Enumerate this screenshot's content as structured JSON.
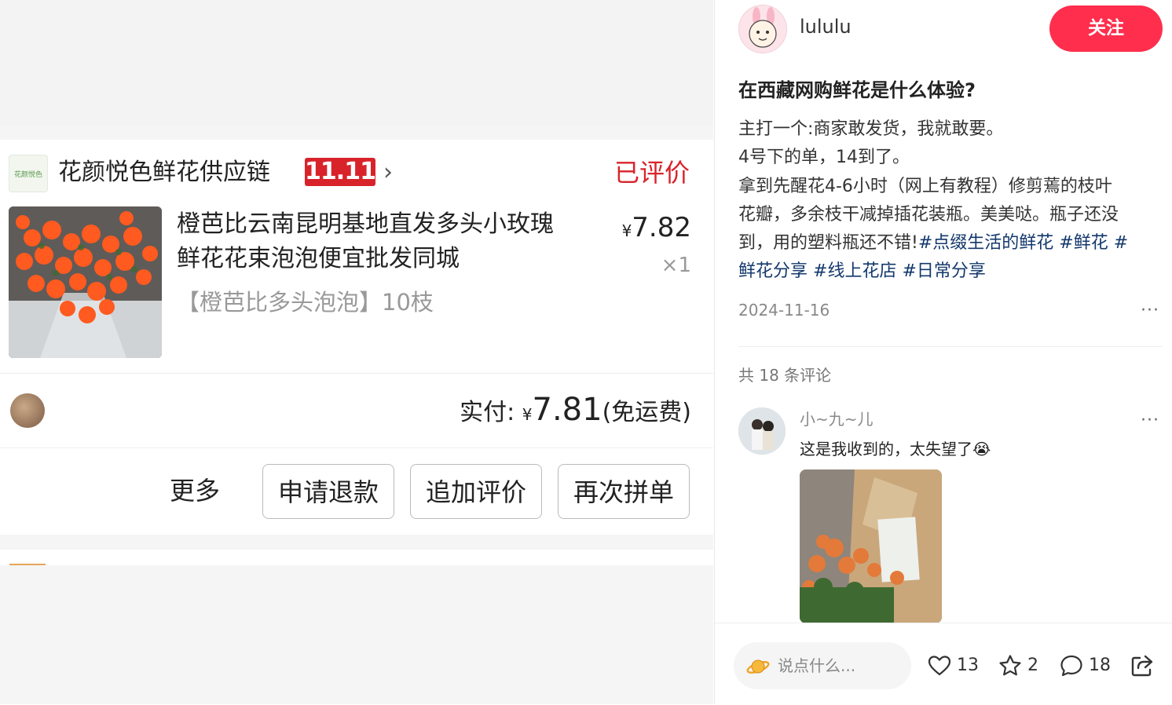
{
  "order": {
    "shop_name": "花颜悦色鲜花供应链",
    "shop_logo_text": "花颜悦色",
    "promo_badge": "11.11",
    "chevron": "›",
    "status": "已评价",
    "product": {
      "title_line1": "橙芭比云南昆明基地直发多头小玫瑰",
      "title_line2": "鲜花花束泡泡便宜批发同城",
      "spec": "【橙芭比多头泡泡】10枝",
      "price_symbol": "¥",
      "price": "7.82",
      "quantity": "×1"
    },
    "paid_label": "实付:",
    "paid_symbol": "¥",
    "paid_amount": "7.81",
    "paid_note": "(免运费)",
    "more_label": "更多",
    "buttons": [
      "申请退款",
      "追加评价",
      "再次拼单"
    ]
  },
  "post": {
    "author_name": "lululu",
    "follow_label": "关注",
    "title": "在西藏网购鲜花是什么体验?",
    "body_line1": "主打一个:商家敢发货，我就敢要。",
    "body_line2": "4号下的单，14到了。",
    "body_line3": "拿到先醒花4-6小时（网上有教程）修剪蔫的枝叶",
    "body_line4": "花瓣，多余枝干减掉插花装瓶。美美哒。瓶子还没",
    "body_line5_text": "到，用的塑料瓶还不错!",
    "tags": [
      "#点缀生活的鲜花",
      "#鲜花",
      "#",
      "鲜花分享",
      "#线上花店",
      "#日常分享"
    ],
    "date": "2024-11-16",
    "more_dots": "···"
  },
  "comments": {
    "count_label": "共 18 条评论",
    "items": [
      {
        "user": "小~九~儿",
        "text": "这是我收到的，太失望了",
        "emoji": "😭",
        "more_dots": "···"
      }
    ]
  },
  "bottom_bar": {
    "input_placeholder": "说点什么...",
    "likes": "13",
    "stars": "2",
    "comments": "18"
  },
  "colors": {
    "accent_red": "#d8232a",
    "follow_red": "#ff2e4d",
    "tag_blue": "#13386c"
  },
  "icons": [
    "planet-icon",
    "heart-icon",
    "star-icon",
    "comment-icon",
    "share-icon",
    "more-icon",
    "chevron-right-icon"
  ]
}
